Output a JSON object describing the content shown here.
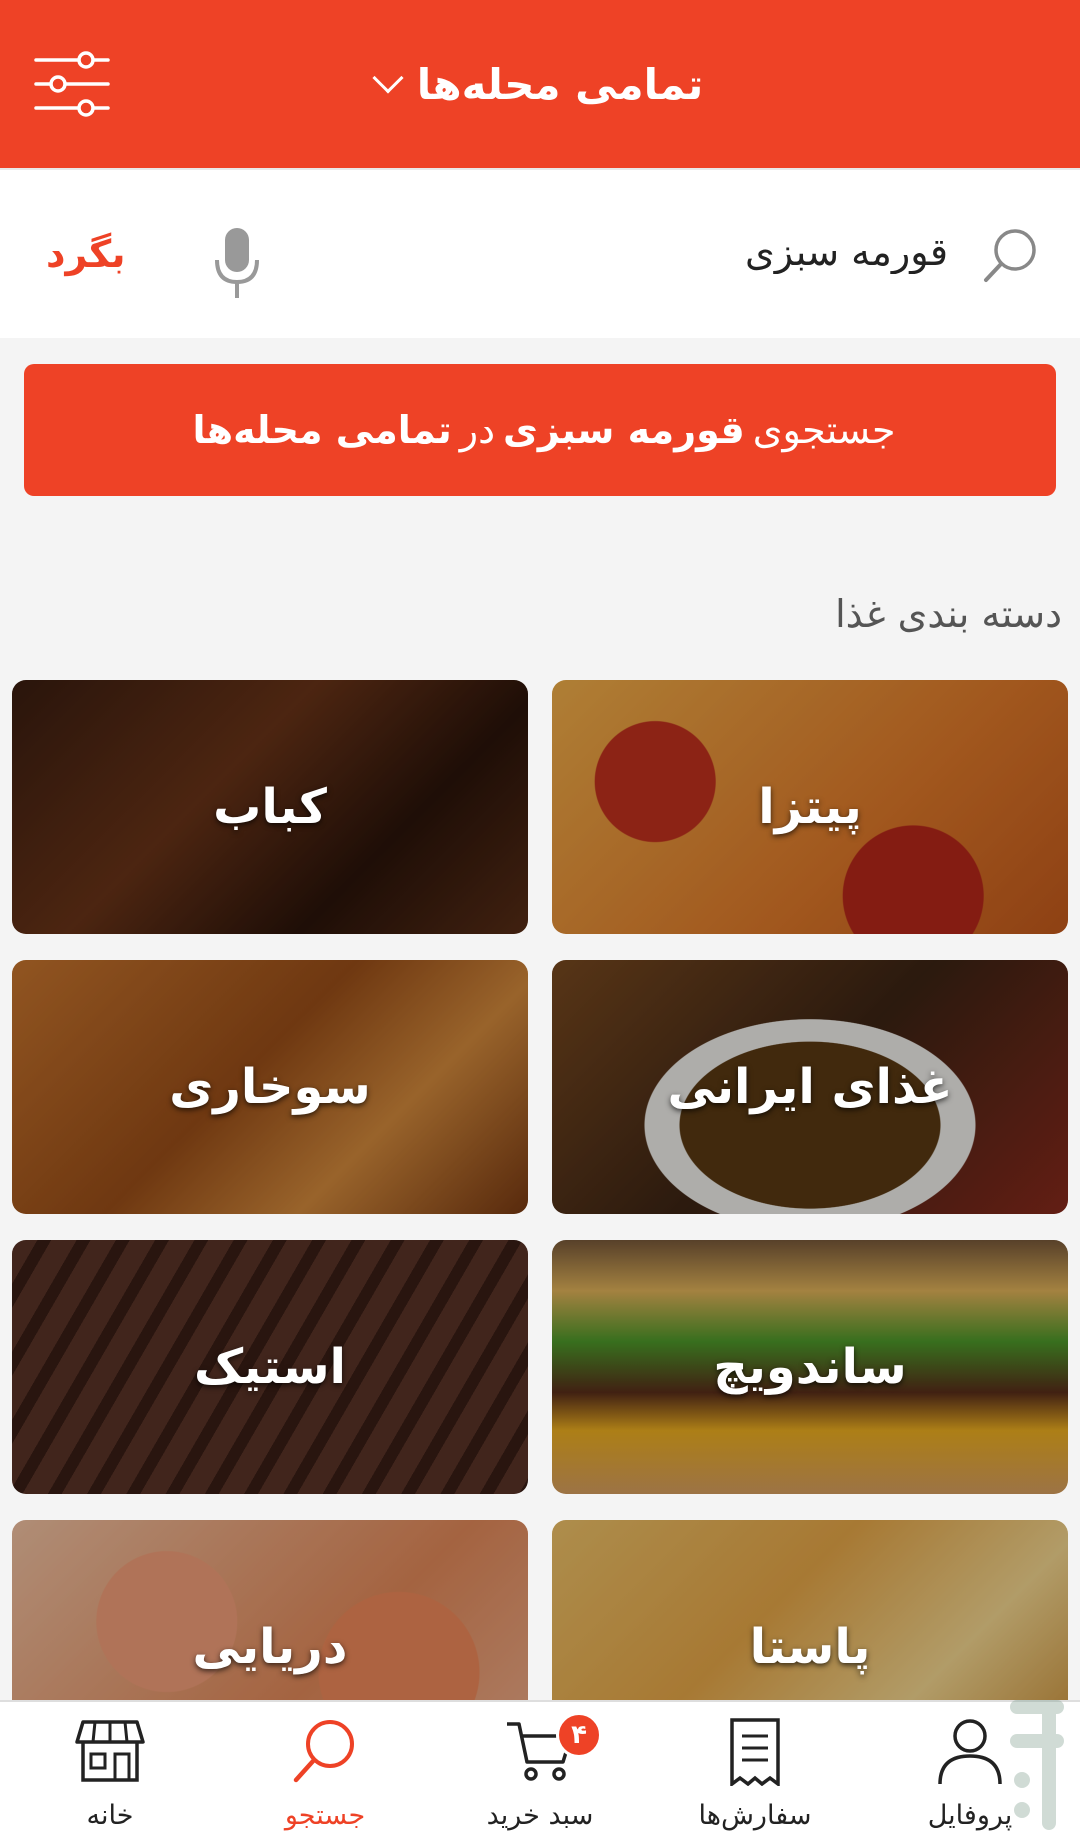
{
  "colors": {
    "accent": "#ee4226",
    "background": "#f4f4f4"
  },
  "header": {
    "title": "تمامی محله‌ها"
  },
  "search": {
    "query": "قورمه سبزی",
    "back_label": "بگرد"
  },
  "search_all": {
    "prefix": "جستجوی",
    "query": "قورمه سبزی",
    "middle": "در",
    "area": "تمامی محله‌ها"
  },
  "section": {
    "title": "دسته بندی غذا"
  },
  "categories": [
    {
      "label": "پیتزا",
      "image": "pizza"
    },
    {
      "label": "کباب",
      "image": "kabab"
    },
    {
      "label": "غذای ایرانی",
      "image": "iranian-food"
    },
    {
      "label": "سوخاری",
      "image": "fried-chicken"
    },
    {
      "label": "ساندویچ",
      "image": "sandwich"
    },
    {
      "label": "استیک",
      "image": "steak"
    },
    {
      "label": "پاستا",
      "image": "pasta"
    },
    {
      "label": "دریایی",
      "image": "seafood"
    }
  ],
  "nav": {
    "profile": "پروفایل",
    "orders": "سفارش‌ها",
    "cart": "سبد خرید",
    "cart_badge": "۴",
    "search": "جستجو",
    "home": "خانه",
    "active": "search"
  }
}
